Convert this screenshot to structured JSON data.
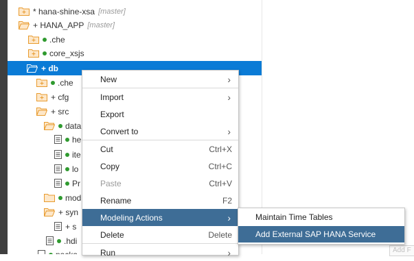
{
  "tree": {
    "rows": [
      {
        "label": "* hana-shine-xsa",
        "branch": "[master]",
        "icon": "folder-closed-icon"
      },
      {
        "label": "+ HANA_APP",
        "branch": "[master]",
        "icon": "folder-open-icon"
      },
      {
        "label": ".che",
        "icon": "folder-closed-icon",
        "status": "green-dot"
      },
      {
        "label": "core_xsjs",
        "icon": "folder-closed-icon",
        "status": "green-dot"
      },
      {
        "label": "+ db",
        "icon": "folder-open-icon",
        "selected": true
      },
      {
        "label": ".che",
        "icon": "folder-closed-icon",
        "status": "green-dot"
      },
      {
        "label": "+ cfg",
        "icon": "folder-closed-icon"
      },
      {
        "label": "+ src",
        "icon": "folder-open-icon"
      },
      {
        "label": "data",
        "icon": "folder-open-icon",
        "status": "green-dot"
      },
      {
        "label": "he",
        "icon": "file-icon",
        "status": "green-dot"
      },
      {
        "label": "ite",
        "icon": "file-icon",
        "status": "green-dot"
      },
      {
        "label": "lo",
        "icon": "file-icon",
        "status": "green-dot"
      },
      {
        "label": "Pr",
        "icon": "file-icon",
        "status": "green-dot"
      },
      {
        "label": "mod",
        "icon": "folder-closed-icon",
        "status": "green-dot"
      },
      {
        "label": "+ syn",
        "icon": "folder-open-icon"
      },
      {
        "label": "+ s",
        "icon": "file-icon"
      },
      {
        "label": ".hdi",
        "icon": "file-icon",
        "status": "green-dot"
      },
      {
        "label": "packa",
        "icon": "file-icon",
        "status": "green-dot"
      }
    ]
  },
  "context_menu": {
    "items": [
      {
        "label": "New",
        "submenu": true
      },
      {
        "label": "Import",
        "submenu": true
      },
      {
        "label": "Export"
      },
      {
        "label": "Convert to",
        "submenu": true
      },
      {
        "label": "Cut",
        "shortcut": "Ctrl+X"
      },
      {
        "label": "Copy",
        "shortcut": "Ctrl+C"
      },
      {
        "label": "Paste",
        "shortcut": "Ctrl+V",
        "disabled": true
      },
      {
        "label": "Rename",
        "shortcut": "F2"
      },
      {
        "label": "Modeling Actions",
        "submenu": true,
        "highlighted": true
      },
      {
        "label": "Delete",
        "shortcut": "Delete"
      },
      {
        "label": "Run",
        "submenu": true
      }
    ]
  },
  "submenu": {
    "items": [
      {
        "label": "Maintain Time Tables"
      },
      {
        "label": "Add External SAP HANA Service",
        "highlighted": true
      }
    ]
  },
  "ghost_button": {
    "label": "Add F"
  },
  "colors": {
    "selection": "#0a7bd6",
    "menu_highlight": "#3e6d96",
    "folder_fill": "#fde7c9",
    "folder_stroke": "#e89a2c",
    "status_dot": "#2f9a2f",
    "gutter": "#3f3f3f"
  },
  "icons": {
    "submenu_arrow": "›"
  }
}
